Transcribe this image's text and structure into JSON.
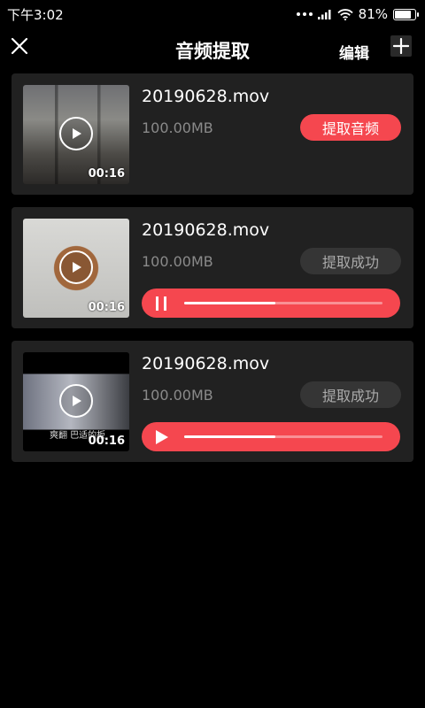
{
  "status_bar": {
    "time": "下午3:02",
    "battery": "81%",
    "battery_level": 0.81
  },
  "header": {
    "title": "音频提取",
    "edit_label": "编辑"
  },
  "icons": {
    "close": "close-icon",
    "add": "plus-icon",
    "play": "play-icon",
    "pause": "pause-icon"
  },
  "colors": {
    "accent": "#f5474f",
    "card": "#212121",
    "background": "#000000"
  },
  "videos": [
    {
      "filename": "20190628.mov",
      "size": "100.00MB",
      "duration": "00:16",
      "action_label": "提取音频",
      "has_player": false
    },
    {
      "filename": "20190628.mov",
      "size": "100.00MB",
      "duration": "00:16",
      "action_label": "提取成功",
      "has_player": true,
      "player_state": "playing",
      "progress": 0.46
    },
    {
      "filename": "20190628.mov",
      "size": "100.00MB",
      "duration": "00:16",
      "action_label": "提取成功",
      "thumb_caption": "爽翻 巴适的板",
      "has_player": true,
      "player_state": "paused",
      "progress": 0.46
    }
  ]
}
